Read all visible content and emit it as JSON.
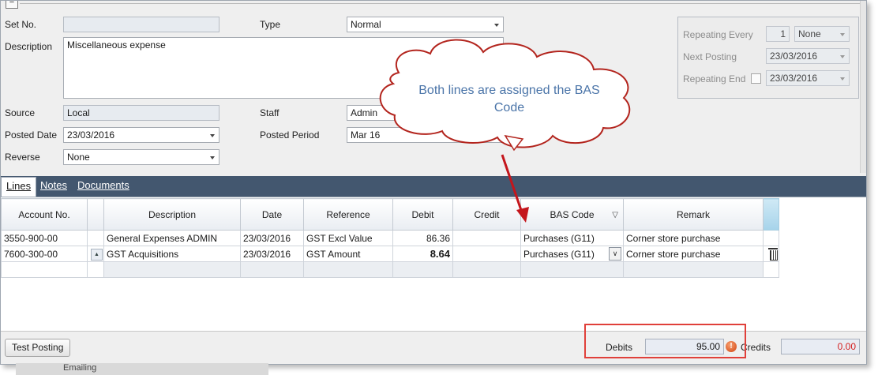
{
  "form": {
    "set_no_label": "Set No.",
    "set_no_value": "",
    "type_label": "Type",
    "type_value": "Normal",
    "description_label": "Description",
    "description_value": "Miscellaneous expense",
    "source_label": "Source",
    "source_value": "Local",
    "staff_label": "Staff",
    "staff_value": "Admin",
    "posted_date_label": "Posted Date",
    "posted_date_value": "23/03/2016",
    "posted_period_label": "Posted Period",
    "posted_period_value": "Mar 16",
    "reverse_label": "Reverse",
    "reverse_value": "None"
  },
  "repeating": {
    "every_label": "Repeating Every",
    "every_count": "1",
    "every_unit": "None",
    "next_label": "Next Posting",
    "next_value": "23/03/2016",
    "end_label": "Repeating End",
    "end_value": "23/03/2016"
  },
  "tabs": [
    {
      "label": "Lines",
      "active": true
    },
    {
      "label": "Notes",
      "active": false
    },
    {
      "label": "Documents",
      "active": false
    }
  ],
  "grid": {
    "columns": [
      "Account No.",
      "",
      "Description",
      "Date",
      "Reference",
      "Debit",
      "Credit",
      "BAS Code",
      "Remark",
      ""
    ],
    "rows": [
      {
        "account": "3550-900-00",
        "description": "General Expenses ADMIN",
        "date": "23/03/2016",
        "reference": "GST Excl Value",
        "debit": "86.36",
        "credit": "",
        "bas_code": "Purchases (G11)",
        "remark": "Corner store purchase"
      },
      {
        "account": "7600-300-00",
        "description": "GST Acquisitions",
        "date": "23/03/2016",
        "reference": "GST Amount",
        "debit": "8.64",
        "credit": "",
        "bas_code": "Purchases (G11)",
        "remark": "Corner store purchase"
      }
    ]
  },
  "footer": {
    "test_posting_label": "Test Posting",
    "debits_label": "Debits",
    "debits_value": "95.00",
    "credits_label": "Credits",
    "credits_value": "0.00",
    "below_text": "Emailing"
  },
  "callout": {
    "text": "Both lines are assigned the BAS Code"
  },
  "colors": {
    "tab_bar": "#43576f",
    "callout_text": "#4a74a8",
    "arrow": "#c4161c",
    "highlight_box": "#e0403a",
    "credits_value": "#d42020"
  },
  "icons": [
    "collapse-icon",
    "chevron-down-icon",
    "sort-arrow-icon",
    "row-expand-icon",
    "delete-icon",
    "warning-icon"
  ]
}
